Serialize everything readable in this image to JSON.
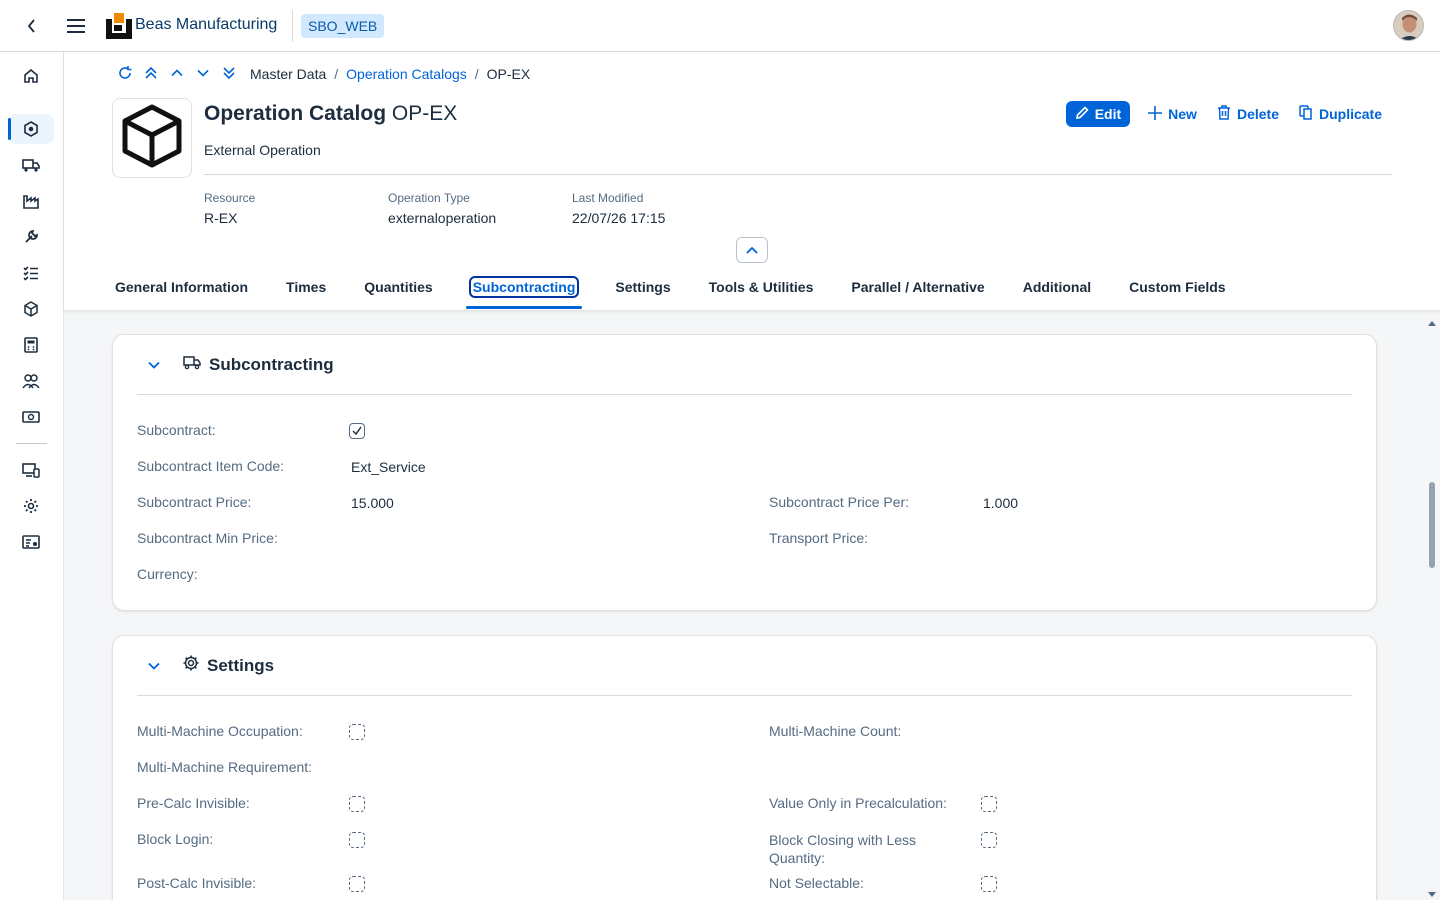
{
  "shell": {
    "app_name": "Beas Manufacturing",
    "system": "SBO_WEB"
  },
  "breadcrumb": {
    "items": [
      "Master Data",
      "Operation Catalogs",
      "OP-EX"
    ],
    "separator": "/"
  },
  "object": {
    "title_prefix": "Operation Catalog",
    "title_id": "OP-EX",
    "subtitle": "External Operation"
  },
  "actions": {
    "edit": "Edit",
    "new": "New",
    "delete": "Delete",
    "duplicate": "Duplicate"
  },
  "kpis": [
    {
      "label": "Resource",
      "value": "R-EX"
    },
    {
      "label": "Operation Type",
      "value": "externaloperation"
    },
    {
      "label": "Last Modified",
      "value": "22/07/26 17:15"
    }
  ],
  "tabs": [
    "General Information",
    "Times",
    "Quantities",
    "Subcontracting",
    "Settings",
    "Tools & Utilities",
    "Parallel / Alternative",
    "Additional",
    "Custom Fields"
  ],
  "active_tab": "Subcontracting",
  "subcontracting": {
    "title": "Subcontracting",
    "subcontract_label": "Subcontract:",
    "subcontract_checked": true,
    "item_code_label": "Subcontract Item Code:",
    "item_code_value": "Ext_Service",
    "price_label": "Subcontract Price:",
    "price_value": "15.000",
    "price_per_label": "Subcontract Price Per:",
    "price_per_value": "1.000",
    "min_price_label": "Subcontract Min Price:",
    "transport_label": "Transport Price:",
    "currency_label": "Currency:"
  },
  "settings": {
    "title": "Settings",
    "multi_occ_label": "Multi-Machine Occupation:",
    "multi_count_label": "Multi-Machine Count:",
    "multi_req_label": "Multi-Machine Requirement:",
    "precalc_inv_label": "Pre-Calc Invisible:",
    "value_only_label": "Value Only in Precalculation:",
    "block_login_label": "Block Login:",
    "block_closing_label": "Block Closing with Less Quantity:",
    "postcalc_inv_label": "Post-Calc Invisible:",
    "not_selectable_label": "Not Selectable:"
  },
  "colors": {
    "accent": "#0064d9",
    "label": "#556b82",
    "text": "#1d2d3e"
  }
}
